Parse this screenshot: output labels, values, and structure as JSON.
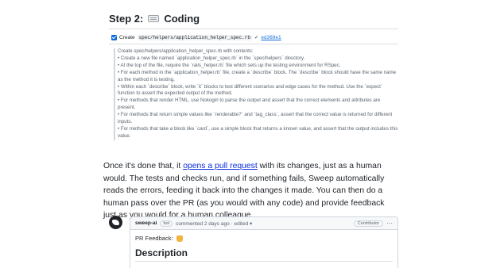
{
  "step": {
    "prefix": "Step 2:",
    "icon": "keyboard-icon",
    "title": "Coding"
  },
  "task": {
    "action": "Create",
    "file": "spec/helpers/application_helper_spec.rb",
    "status_mark": "✓",
    "commit": "ed369e1"
  },
  "instructions": [
    "Create spec/helpers/application_helper_spec.rb with contents:",
    "• Create a new file named `application_helper_spec.rb` in the `spec/helpers` directory.",
    "• At the top of the file, require the `rails_helper.rb` file which sets up the testing environment for RSpec.",
    "• For each method in the `application_helper.rb` file, create a `describe` block. The `describe` block should have the same name as the method it is testing.",
    "• Within each `describe` block, write `it` blocks to test different scenarios and edge cases for the method. Use the `expect` function to assert the expected output of the method.",
    "• For methods that render HTML, use Nokogiri to parse the output and assert that the correct elements and attributes are present.",
    "• For methods that return simple values like `renderable?` and `tag_class`, assert that the correct value is returned for different inputs.",
    "• For methods that take a block like `card`, use a simple block that returns a known value, and assert that the output includes this value."
  ],
  "paragraph": {
    "before_link": "Once it's done that, it ",
    "link_text": "opens a pull request",
    "after_link": " with its changes, just as a human would. The tests and checks run, and if something fails, Sweep automatically reads the errors, feeding it back into the changes it made. You can then do a human pass over the PR (as you would with any code) and provide feedback just as you would for a human colleague."
  },
  "comment": {
    "author": "sweep-ai",
    "bot_badge": "bot",
    "meta": "commented 2 days ago · edited ▾",
    "role_badge": "Contributor",
    "more": "···",
    "feedback_label": "PR Feedback:",
    "feedback_icon": "thumbs-up-icon",
    "heading": "Description"
  },
  "colors": {
    "link": "#0a2bde",
    "commit_link": "#0969da",
    "checkbox": "#0969da"
  }
}
